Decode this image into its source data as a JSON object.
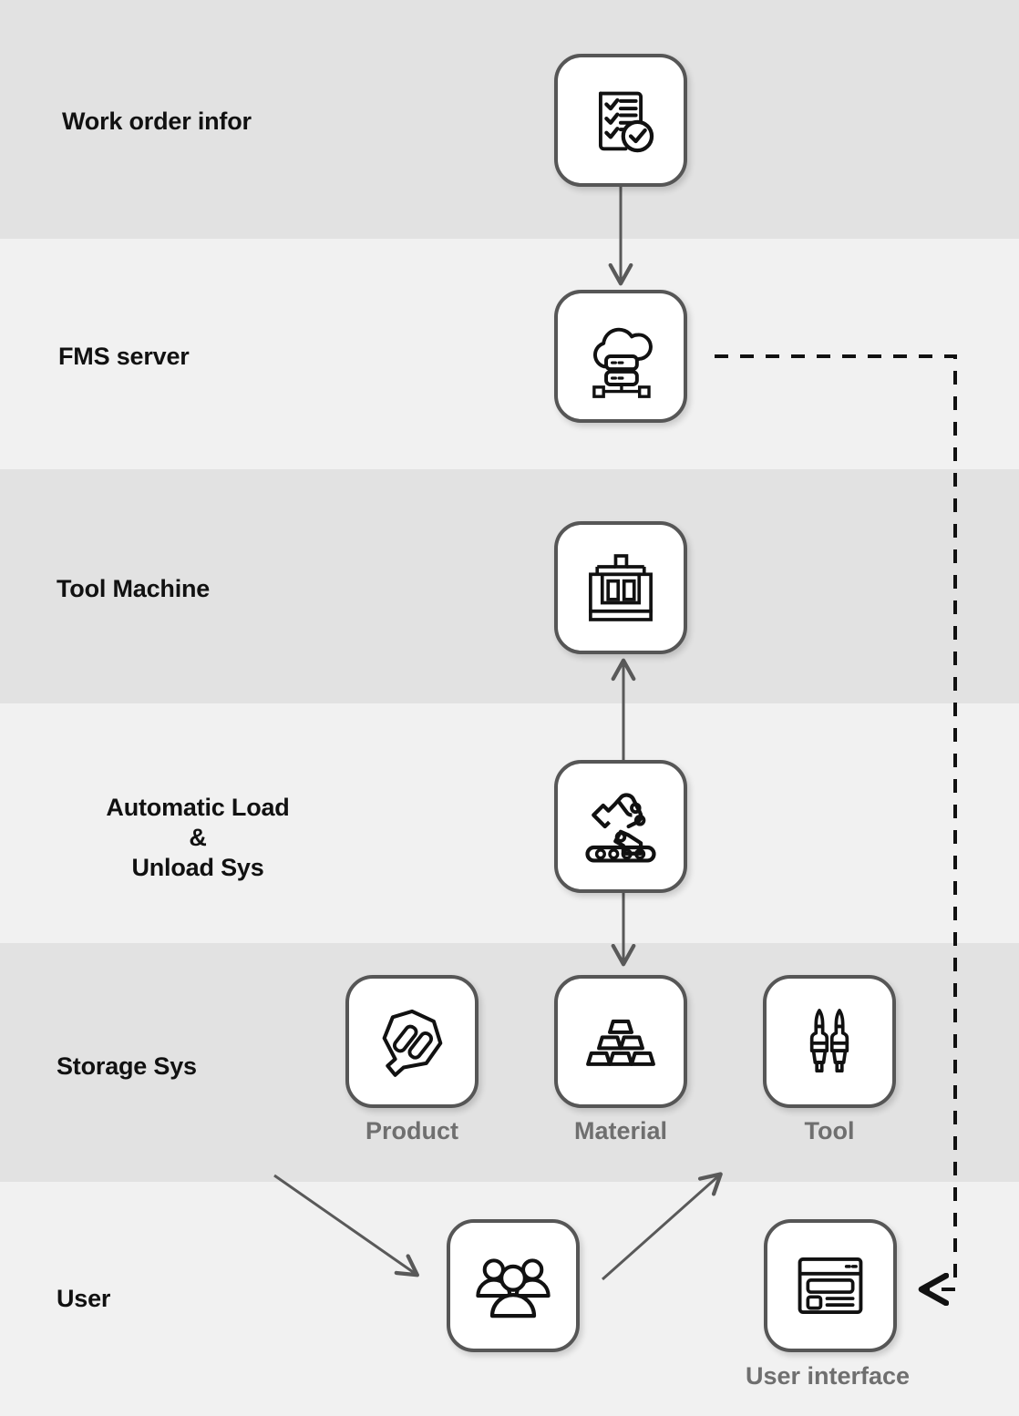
{
  "diagram": {
    "title": "FMS system architecture flow",
    "background_color": "#f1f1f1",
    "band_dark_color": "#e2e2e2",
    "band_light_color": "#f1f1f1",
    "tile_border_color": "#565656",
    "connector_color": "#595959",
    "dashed_connector_color": "#111111",
    "caption_color": "#6f6f6f",
    "label_color": "#111111"
  },
  "rows": [
    {
      "id": "work-order",
      "label": "Work order infor",
      "band": "dark"
    },
    {
      "id": "fms-server",
      "label": "FMS server",
      "band": "light"
    },
    {
      "id": "tool-machine",
      "label": "Tool Machine",
      "band": "dark"
    },
    {
      "id": "load-unload",
      "label": "Automatic Load\n&\nUnload Sys",
      "band": "light"
    },
    {
      "id": "storage-sys",
      "label": "Storage Sys",
      "band": "dark"
    },
    {
      "id": "user",
      "label": "User",
      "band": "light"
    }
  ],
  "nodes": {
    "work_order": {
      "icon": "checklist-document-icon",
      "caption": ""
    },
    "fms_server": {
      "icon": "cloud-server-icon",
      "caption": ""
    },
    "tool_machine": {
      "icon": "cnc-machine-icon",
      "caption": ""
    },
    "load_unload": {
      "icon": "robot-arm-conveyor-icon",
      "caption": ""
    },
    "product": {
      "icon": "product-part-icon",
      "caption": "Product"
    },
    "material": {
      "icon": "material-ingots-icon",
      "caption": "Material"
    },
    "tool": {
      "icon": "cutting-tools-icon",
      "caption": "Tool"
    },
    "users": {
      "icon": "people-group-icon",
      "caption": ""
    },
    "user_interface": {
      "icon": "browser-window-icon",
      "caption": "User interface"
    }
  },
  "connections": [
    {
      "id": "work-order-to-fms",
      "from": "work_order",
      "to": "fms_server",
      "style": "solid",
      "direction": "down"
    },
    {
      "id": "load-unload-to-machine",
      "from": "load_unload",
      "to": "tool_machine",
      "style": "solid",
      "direction": "up"
    },
    {
      "id": "load-unload-to-storage",
      "from": "load_unload",
      "to": "material",
      "style": "solid",
      "direction": "down"
    },
    {
      "id": "product-to-users",
      "from": "product",
      "to": "users",
      "style": "solid",
      "direction": "down-right"
    },
    {
      "id": "users-to-material",
      "from": "users",
      "to": "material",
      "style": "solid",
      "direction": "up-right"
    },
    {
      "id": "fms-to-user-interface",
      "from": "fms_server",
      "to": "user_interface",
      "style": "dashed",
      "direction": "left"
    }
  ]
}
